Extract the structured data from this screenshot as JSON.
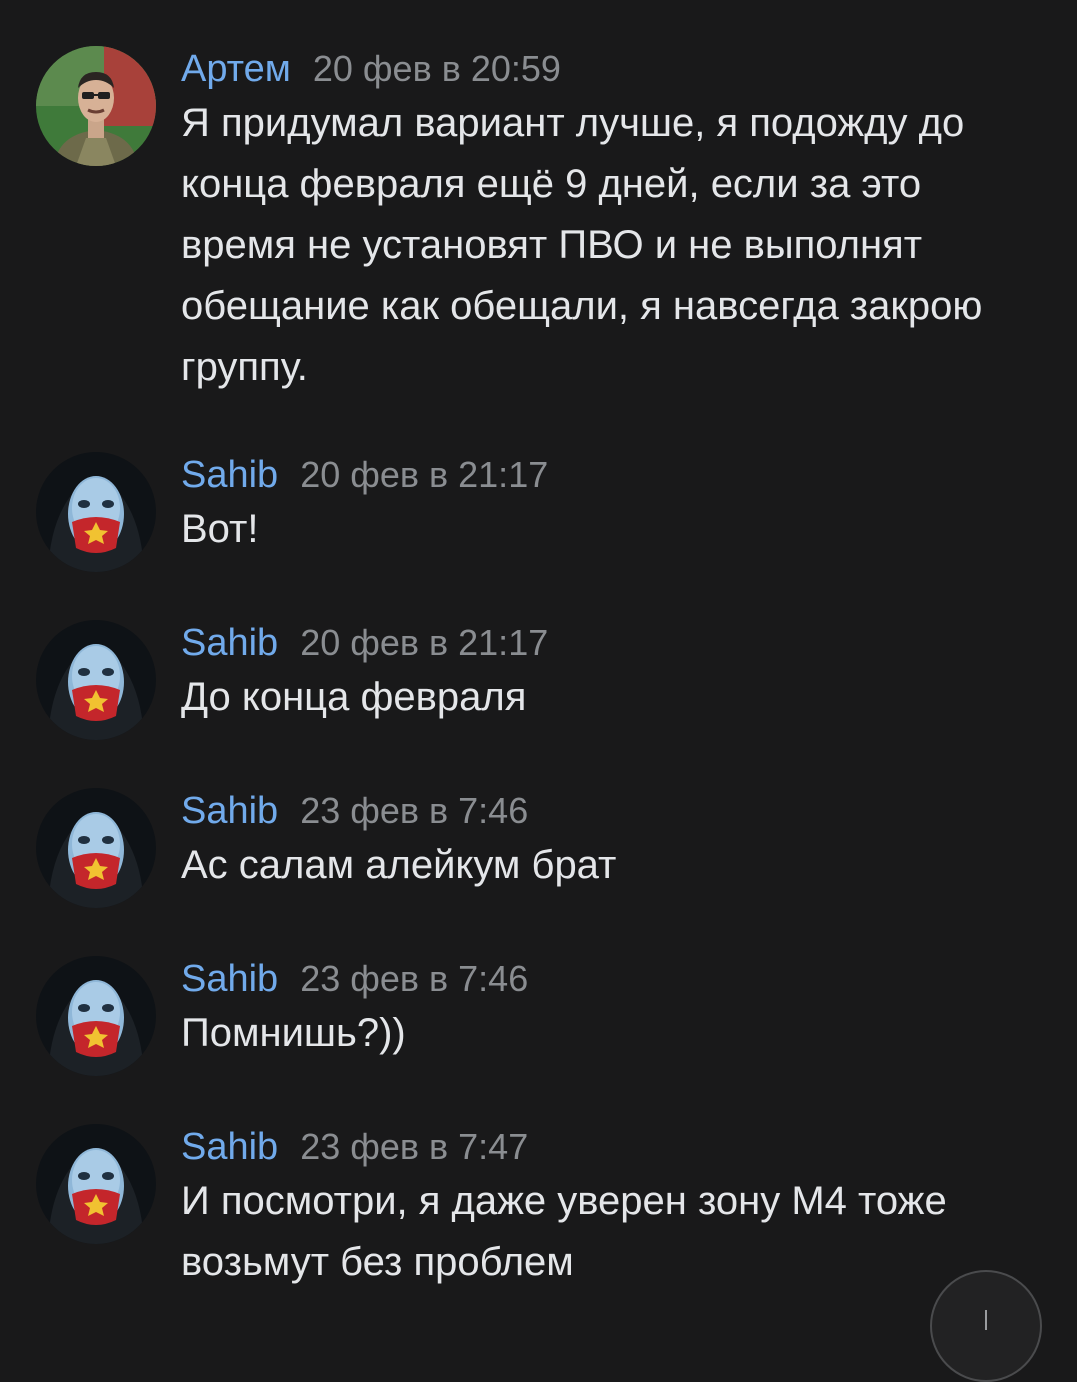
{
  "messages": [
    {
      "author": "Артем",
      "time": "20 фев в 20:59",
      "text": "Я придумал вариант лучше, я подожду до конца февраля ещё 9 дней, если за это время не установят ПВО и не выполнят обещание как обещали, я навсегда закрою группу.",
      "avatar": "man-portrait-avatar"
    },
    {
      "author": "Sahib",
      "time": "20 фев в 21:17",
      "text": "Вот!",
      "avatar": "masked-face-avatar"
    },
    {
      "author": "Sahib",
      "time": "20 фев в 21:17",
      "text": "До конца февраля",
      "avatar": "masked-face-avatar"
    },
    {
      "author": "Sahib",
      "time": "23 фев в 7:46",
      "text": "Ас салам алейкум брат",
      "avatar": "masked-face-avatar"
    },
    {
      "author": "Sahib",
      "time": "23 фев в 7:46",
      "text": "Помнишь?))",
      "avatar": "masked-face-avatar"
    },
    {
      "author": "Sahib",
      "time": "23 фев в 7:47",
      "text": "И посмотри, я даже уверен зону М4 тоже возьмут без проблем",
      "avatar": "masked-face-avatar"
    }
  ],
  "scroll_button": {
    "icon": "arrow-down-icon"
  },
  "colors": {
    "background": "#19191a",
    "author_name": "#71aaeb",
    "timestamp": "#8a8d91",
    "message_text": "#e4e6e9"
  }
}
